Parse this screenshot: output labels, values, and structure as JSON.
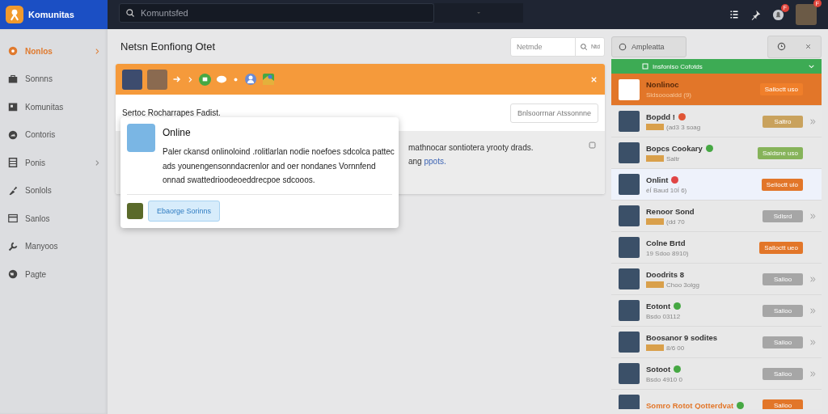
{
  "topbar": {
    "app_name": "Komunitas",
    "search": {
      "placeholder": "Komuntsfed"
    },
    "notification_badge": "F",
    "avatar_badge": "F"
  },
  "sidebar": {
    "items": [
      {
        "label": "Nonlos",
        "selected": true,
        "chevron": true
      },
      {
        "label": "Sonnns",
        "selected": false,
        "chevron": false
      },
      {
        "label": "Komunitas",
        "selected": false,
        "chevron": false
      },
      {
        "label": "Contoris",
        "selected": false,
        "chevron": false
      },
      {
        "label": "Ponis",
        "selected": false,
        "chevron": true
      },
      {
        "label": "Sonlols",
        "selected": false,
        "chevron": false
      },
      {
        "label": "Sanlos",
        "selected": false,
        "chevron": false
      },
      {
        "label": "Manyoos",
        "selected": false,
        "chevron": false
      },
      {
        "label": "Pagte",
        "selected": false,
        "chevron": false
      }
    ]
  },
  "header": {
    "title": "Netsn Eonfiong Otet",
    "filter": {
      "placeholder": "Netmde"
    },
    "search_button": "Ntd",
    "action_button": "Ampleatta"
  },
  "card": {
    "intro": "Sertoc Rocharrapes Fadist.",
    "intro_button": "Bnlsoorrnar Atssonnne",
    "body_line_1": "mathnocar sontiotera yrooty drads.",
    "body_line_2": "ang",
    "body_link": "ppots."
  },
  "popover": {
    "title": "Online",
    "text": "Paler ckansd onlinoloind .rolitlarlan nodie noefoes sdcolca pattec ads younengensonndacrenlor and oer nondanes Vornnfend onnad swattedrioodeoeddrecpoe sdcooos.",
    "button": "Ebaorge Sorinns"
  },
  "panel": {
    "title": "Insfonlso Cofotds",
    "rows": [
      {
        "kind": "featured",
        "selected": false,
        "title": "Nonlinoc",
        "subtitle": "Sldsoooaldd (9)",
        "button": {
          "label": "Salloctt uso",
          "color": "#f07f2a"
        },
        "tag": false,
        "chevron": false
      },
      {
        "kind": "normal",
        "selected": false,
        "title": "Bopdd !",
        "status": {
          "color": "#e05535"
        },
        "subtitle": "(ad3 3 soag",
        "button": {
          "label": "Saltro",
          "color": "#c9a25d"
        },
        "tag": true,
        "chevron": true
      },
      {
        "kind": "normal",
        "selected": false,
        "title": "Bopcs Cookary",
        "status": {
          "color": "#46a843"
        },
        "subtitle": "Saltr",
        "button": {
          "label": "Saldsne uso",
          "color": "#86b35a"
        },
        "tag": true,
        "chevron": false
      },
      {
        "kind": "normal",
        "selected": true,
        "title": "Onlint",
        "status": {
          "color": "#e04545"
        },
        "subtitle": "éÍ Baud 10Í 6)",
        "button": {
          "label": "Selloctt ulo",
          "color": "#e27629"
        },
        "tag": false,
        "chevron": false
      },
      {
        "kind": "normal",
        "selected": false,
        "title": "Renoor Sond",
        "subtitle": "(dd 70",
        "button": {
          "label": "Sdlsrd",
          "color": "#a6a6a6"
        },
        "tag": true,
        "chevron": true
      },
      {
        "kind": "normal",
        "selected": false,
        "title": "Colne Brtd",
        "subtitle": "19 Sdoo 8910)",
        "button": {
          "label": "Salloctt ueo",
          "color": "#e27629"
        },
        "tag": false,
        "chevron": false
      },
      {
        "kind": "normal",
        "selected": false,
        "title": "Doodrits 8",
        "subtitle": "Choo 3olgg",
        "button": {
          "label": "Salloo",
          "color": "#a6a6a6"
        },
        "tag": true,
        "chevron": true
      },
      {
        "kind": "normal",
        "selected": false,
        "title": "Eotont",
        "status": {
          "color": "#46a843"
        },
        "subtitle": "Bsdo 03112",
        "button": {
          "label": "Salloo",
          "color": "#a6a6a6"
        },
        "tag": false,
        "chevron": true
      },
      {
        "kind": "normal",
        "selected": false,
        "title": "Boosanor 9 sodites",
        "subtitle": "8/6 00",
        "button": {
          "label": "Salloo",
          "color": "#a6a6a6"
        },
        "tag": true,
        "chevron": true
      },
      {
        "kind": "normal",
        "selected": false,
        "title": "Sotoot",
        "status": {
          "color": "#46a843"
        },
        "subtitle": "Bsdo 4910 0",
        "button": {
          "label": "Salloo",
          "color": "#a6a6a6"
        },
        "tag": false,
        "chevron": true
      },
      {
        "kind": "highlight",
        "selected": false,
        "title": "Somro Rotot Qotterdvat",
        "status": {
          "color": "#46a843"
        },
        "button": {
          "label": "Salloo",
          "color": "#e27629"
        },
        "tag": false,
        "chevron": false
      }
    ]
  }
}
